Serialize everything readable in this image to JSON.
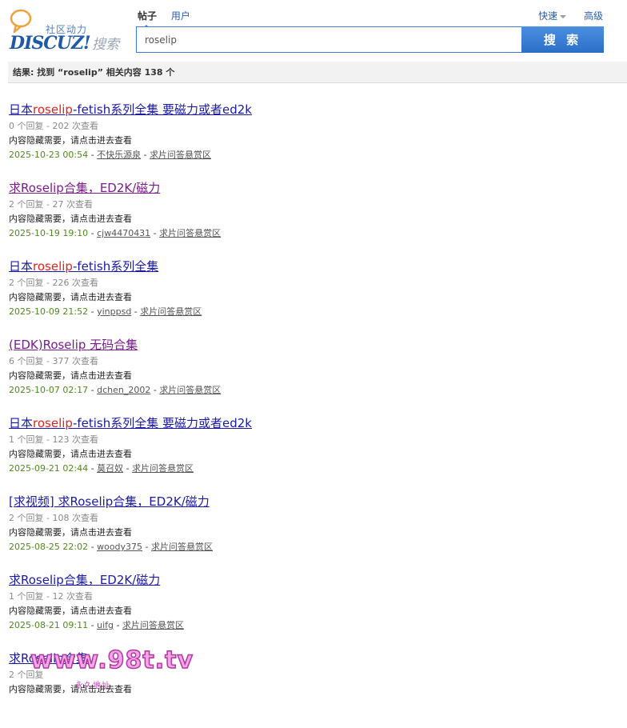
{
  "logo": {
    "tagline": "社区动力",
    "wordmark": "DISCUZ!",
    "search_word": "搜索"
  },
  "tabs": [
    {
      "label": "帖子",
      "active": true
    },
    {
      "label": "用户",
      "active": false
    }
  ],
  "right_links": {
    "quick": "快速",
    "advanced": "高级"
  },
  "search": {
    "value": "roselip",
    "button_label": "搜 索"
  },
  "summary": "结果: 找到 “roselip” 相关内容 138 个",
  "results": [
    {
      "title_parts": [
        "日本",
        "roselip",
        "-fetish系列全集 要磁力或者ed2k"
      ],
      "highlight": true,
      "visited": false,
      "meta": "0 个回复 - 202 次查看",
      "excerpt": "内容隐藏需要，请点击进去查看",
      "date": "2025-10-23 00:54",
      "author": "不快乐源泉",
      "forum": "求片问答悬赏区"
    },
    {
      "title_parts": [
        "求Roselip合集，ED2K/磁力",
        "",
        ""
      ],
      "highlight": false,
      "visited": true,
      "meta": "2 个回复 - 27 次查看",
      "excerpt": "内容隐藏需要，请点击进去查看",
      "date": "2025-10-19 19:10",
      "author": "cjw4470431",
      "forum": "求片问答悬赏区"
    },
    {
      "title_parts": [
        "日本",
        "roselip",
        "-fetish系列全集"
      ],
      "highlight": true,
      "visited": false,
      "meta": "2 个回复 - 226 次查看",
      "excerpt": "内容隐藏需要，请点击进去查看",
      "date": "2025-10-09 21:52",
      "author": "yinppsd",
      "forum": "求片问答悬赏区"
    },
    {
      "title_parts": [
        "(EDK)Roselip 无码合集",
        "",
        ""
      ],
      "highlight": false,
      "visited": true,
      "meta": "6 个回复 - 377 次查看",
      "excerpt": "内容隐藏需要，请点击进去查看",
      "date": "2025-10-07 02:17",
      "author": "dchen_2002",
      "forum": "求片问答悬赏区"
    },
    {
      "title_parts": [
        "日本",
        "roselip",
        "-fetish系列全集 要磁力或者ed2k"
      ],
      "highlight": true,
      "visited": false,
      "meta": "1 个回复 - 123 次查看",
      "excerpt": "内容隐藏需要，请点击进去查看",
      "date": "2025-09-21 02:44",
      "author": "莫召奴",
      "forum": "求片问答悬赏区"
    },
    {
      "title_parts": [
        "[求视频] 求Roselip合集，ED2K/磁力",
        "",
        ""
      ],
      "highlight": false,
      "visited": false,
      "meta": "2 个回复 - 108 次查看",
      "excerpt": "内容隐藏需要，请点击进去查看",
      "date": "2025-08-25 22:02",
      "author": "woody375",
      "forum": "求片问答悬赏区"
    },
    {
      "title_parts": [
        "求Roselip合集，ED2K/磁力",
        "",
        ""
      ],
      "highlight": false,
      "visited": false,
      "meta": "1 个回复 - 12 次查看",
      "excerpt": "内容隐藏需要，请点击进去查看",
      "date": "2025-08-21 09:11",
      "author": "uifg",
      "forum": "求片问答悬赏区"
    },
    {
      "title_parts": [
        "求Roselip合集",
        "",
        ""
      ],
      "highlight": false,
      "visited": false,
      "meta": "2 个回复",
      "excerpt": "内容隐藏需要，请点击进去查看",
      "date": "",
      "author": "",
      "forum": ""
    }
  ],
  "watermark": {
    "main": "www.98t.tv",
    "sub": "永久地址"
  },
  "colors": {
    "link": "#1a1aa6",
    "visited": "#7a1d8c",
    "highlight": "#e0241b",
    "date": "#4e8a1a",
    "accent": "#3b7dd8"
  }
}
